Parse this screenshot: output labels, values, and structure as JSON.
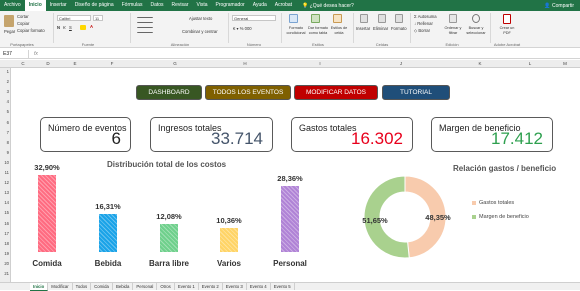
{
  "ribbon_tabs": [
    "Archivo",
    "Inicio",
    "Insertar",
    "Diseño de página",
    "Fórmulas",
    "Datos",
    "Revisar",
    "Vista",
    "Programador",
    "Ayuda",
    "Acrobat"
  ],
  "active_tab_index": 1,
  "tell_me": "¿Qué desea hacer?",
  "share": "Compartir",
  "ribbon": {
    "cut": "Cortar",
    "copy": "Copiar",
    "format_painter": "Copiar formato",
    "paste": "Pegar",
    "font_name": "Calibri",
    "font_size": "11",
    "wrap_text": "Ajustar texto",
    "merge_center": "Combinar y centrar",
    "number_format": "General",
    "conditional_format": "Formato condicional",
    "format_as_table": "Dar formato como tabla",
    "cell_styles": "Estilos de celda",
    "insert": "Insertar",
    "delete": "Eliminar",
    "format": "Formato",
    "autosum": "Autosuma",
    "fill": "Rellenar",
    "clear": "Borrar",
    "sort_filter": "Ordenar y filtrar",
    "find_select": "Buscar y seleccionar",
    "create_pdf": "Crear un PDF",
    "groups": [
      "Portapapeles",
      "Fuente",
      "Alineación",
      "Número",
      "Estilos",
      "Celdas",
      "Edición",
      "Adobe Acrobat"
    ]
  },
  "formula_bar": {
    "name_box": "E37",
    "fx": "fx"
  },
  "columns": [
    "C",
    "D",
    "E",
    "F",
    "G",
    "H",
    "I",
    "J",
    "K",
    "L",
    "M"
  ],
  "rows": [
    "1",
    "2",
    "3",
    "4",
    "5",
    "6",
    "7",
    "8",
    "9",
    "10",
    "11",
    "12",
    "13",
    "14",
    "15",
    "16",
    "17",
    "18",
    "19",
    "20",
    "21"
  ],
  "nav_buttons": [
    {
      "label": "DASHBOARD",
      "color": "#385723"
    },
    {
      "label": "TODOS LOS EVENTOS",
      "color": "#7f6000"
    },
    {
      "label": "MODIFICAR DATOS",
      "color": "#c00000"
    },
    {
      "label": "TUTORIAL",
      "color": "#1f4e79"
    }
  ],
  "cards": [
    {
      "label": "Número de eventos",
      "value": "6",
      "color": "#222222"
    },
    {
      "label": "Ingresos totales",
      "value": "33.714",
      "color": "#44546a"
    },
    {
      "label": "Gastos totales",
      "value": "16.302",
      "color": "#e8001c"
    },
    {
      "label": "Margen de beneficio",
      "value": "17.412",
      "color": "#2ea04f"
    }
  ],
  "chart_data": [
    {
      "type": "bar",
      "title": "Distribución total de los costos",
      "categories": [
        "Comida",
        "Bebida",
        "Barra libre",
        "Varios",
        "Personal"
      ],
      "values": [
        32.9,
        16.31,
        12.08,
        10.36,
        28.36
      ],
      "labels": [
        "32,90%",
        "16,31%",
        "12,08%",
        "10,36%",
        "28,36%"
      ],
      "colors": [
        "#ff6b81",
        "#1aa3e8",
        "#6fd08c",
        "#ffd466",
        "#b083d6"
      ],
      "ylim": [
        0,
        35
      ]
    },
    {
      "type": "pie",
      "title": "Relación gastos / beneficio",
      "categories": [
        "Gastos totales",
        "Margen de beneficio"
      ],
      "values": [
        48.35,
        51.65
      ],
      "labels": [
        "48,35%",
        "51,65%"
      ],
      "colors": [
        "#f8cbad",
        "#a9d18e"
      ],
      "legend": "right"
    }
  ],
  "sheet_tabs": [
    "Inicio",
    "Modificar",
    "Todos",
    "Comida",
    "Bebida",
    "Personal",
    "Otros",
    "Evento 1",
    "Evento 2",
    "Evento 3",
    "Evento 4",
    "Evento 5"
  ],
  "active_sheet_index": 0
}
